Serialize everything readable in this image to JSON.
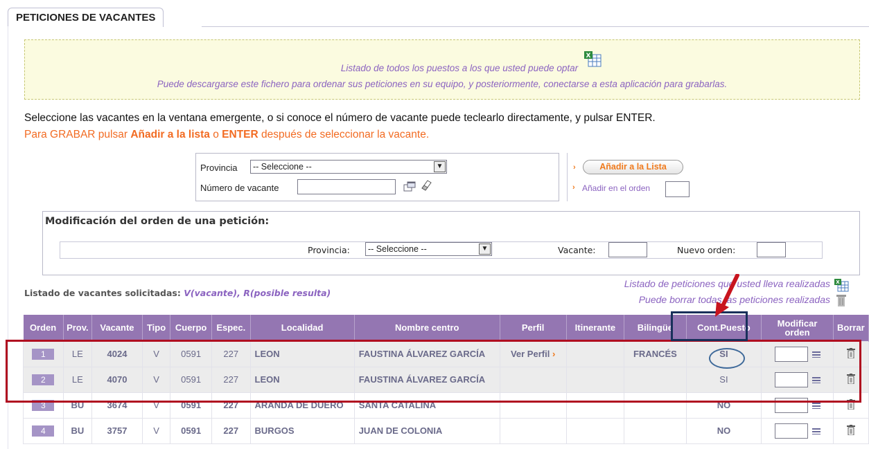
{
  "tab": {
    "title": "PETICIONES DE VACANTES"
  },
  "infobox": {
    "line1": "Listado de todos los puestos a los que usted puede optar",
    "line2": "Puede descargarse este fichero para ordenar sus peticiones en su equipo, y posteriormente, conectarse a esta aplicación para grabarlas.",
    "icon": "excel-icon"
  },
  "instructions": {
    "line1": "Seleccione las vacantes en la ventana emergente, o si conoce el número de vacante puede teclearlo directamente, y pulsar ENTER.",
    "line2_a": "Para GRABAR pulsar ",
    "line2_b": "Añadir a la lista",
    "line2_c": " o ",
    "line2_d": "ENTER",
    "line2_e": " después de seleccionar la vacante."
  },
  "select_form": {
    "provincia_label": "Provincia",
    "provincia_value": "-- Seleccione --",
    "numero_label": "Número de vacante",
    "numero_value": ""
  },
  "add_panel": {
    "add_button": "Añadir a la Lista",
    "add_order_label": "Añadir en el orden",
    "add_order_value": ""
  },
  "modify": {
    "title": "Modificación del orden de una petición:",
    "provincia_label": "Provincia:",
    "provincia_value": "-- Seleccione --",
    "vacante_label": "Vacante:",
    "vacante_value": "",
    "nuevo_orden_label": "Nuevo orden:",
    "nuevo_orden_value": ""
  },
  "list": {
    "title_a": "Listado de vacantes solicitadas: ",
    "title_b": "V(vacante), R(posible resulta)",
    "link_peticiones": "Listado de peticiones que usted lleva realizadas",
    "link_borrar": "Puede borrar todas las peticiones realizadas"
  },
  "table": {
    "headers": {
      "orden": "Orden",
      "prov": "Prov.",
      "vacante": "Vacante",
      "tipo": "Tipo",
      "cuerpo": "Cuerpo",
      "espec": "Espec.",
      "localidad": "Localidad",
      "centro": "Nombre centro",
      "perfil": "Perfil",
      "itinerante": "Itinerante",
      "bilingue": "Bilingüe",
      "cont": "Cont.Puesto",
      "modificar_1": "Modificar",
      "modificar_2": "orden",
      "borrar": "Borrar"
    },
    "rows": [
      {
        "orden": "1",
        "prov": "LE",
        "vacante": "4024",
        "tipo": "V",
        "cuerpo": "0591",
        "espec": "227",
        "localidad": "LEON",
        "centro": "FAUSTINA ÁLVAREZ GARCÍA",
        "perfil": "Ver Perfil",
        "itinerante": "",
        "bilingue": "FRANCÉS",
        "cont": "SI"
      },
      {
        "orden": "2",
        "prov": "LE",
        "vacante": "4070",
        "tipo": "V",
        "cuerpo": "0591",
        "espec": "227",
        "localidad": "LEON",
        "centro": "FAUSTINA ÁLVAREZ GARCÍA",
        "perfil": "",
        "itinerante": "",
        "bilingue": "",
        "cont": "SI"
      },
      {
        "orden": "3",
        "prov": "BU",
        "vacante": "3674",
        "tipo": "V",
        "cuerpo": "0591",
        "espec": "227",
        "localidad": "ARANDA DE DUERO",
        "centro": "SANTA CATALINA",
        "perfil": "",
        "itinerante": "",
        "bilingue": "",
        "cont": "NO"
      },
      {
        "orden": "4",
        "prov": "BU",
        "vacante": "3757",
        "tipo": "V",
        "cuerpo": "0591",
        "espec": "227",
        "localidad": "BURGOS",
        "centro": "JUAN DE COLONIA",
        "perfil": "",
        "itinerante": "",
        "bilingue": "",
        "cont": "NO"
      }
    ]
  },
  "colors": {
    "accent_purple": "#9476b2",
    "orange": "#f26b22",
    "annotation_red": "#b00e20",
    "annotation_navy": "#18305a"
  }
}
